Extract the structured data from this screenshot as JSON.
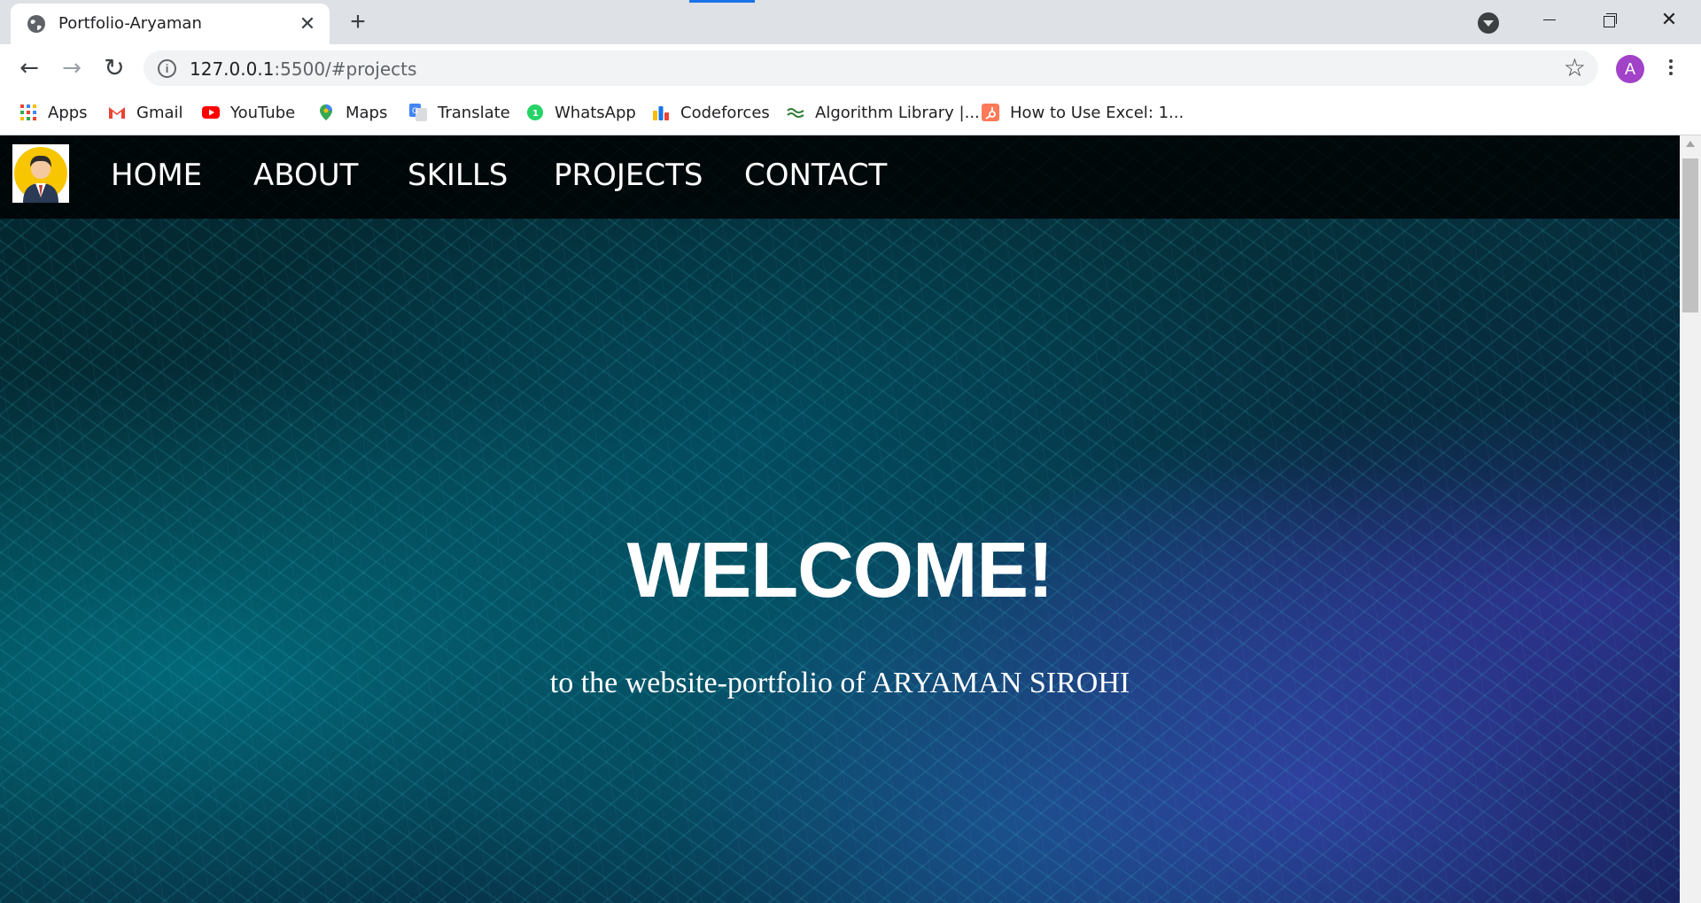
{
  "browser": {
    "tab_title": "Portfolio-Aryaman",
    "url_host": "127.0.0.1",
    "url_rest": ":5500/#projects",
    "profile_initial": "A",
    "tab_close": "✕",
    "new_tab": "+",
    "window_close": "✕",
    "back": "←",
    "forward": "→",
    "reload": "↻",
    "star": "☆"
  },
  "bookmarks": [
    {
      "label": "Apps",
      "icon": "apps-grid-icon"
    },
    {
      "label": "Gmail",
      "icon": "gmail-icon"
    },
    {
      "label": "YouTube",
      "icon": "youtube-icon"
    },
    {
      "label": "Maps",
      "icon": "maps-icon"
    },
    {
      "label": "Translate",
      "icon": "translate-icon"
    },
    {
      "label": "WhatsApp",
      "icon": "whatsapp-icon"
    },
    {
      "label": "Codeforces",
      "icon": "codeforces-icon"
    },
    {
      "label": "Algorithm Library |...",
      "icon": "algorithm-library-icon"
    },
    {
      "label": "How to Use Excel: 1...",
      "icon": "hubspot-icon"
    }
  ],
  "site": {
    "nav": [
      "HOME",
      "ABOUT",
      "SKILLS",
      "PROJECTS",
      "CONTACT"
    ],
    "hero_title": "WELCOME!",
    "hero_subtitle": "to the website-portfolio of ARYAMAN SIROHI"
  },
  "colors": {
    "tabstrip": "#dee1e6",
    "navbar": "#000000",
    "hero_teal": "#05303b",
    "hero_purple": "#5046dc",
    "avatar": "#a142c8"
  }
}
